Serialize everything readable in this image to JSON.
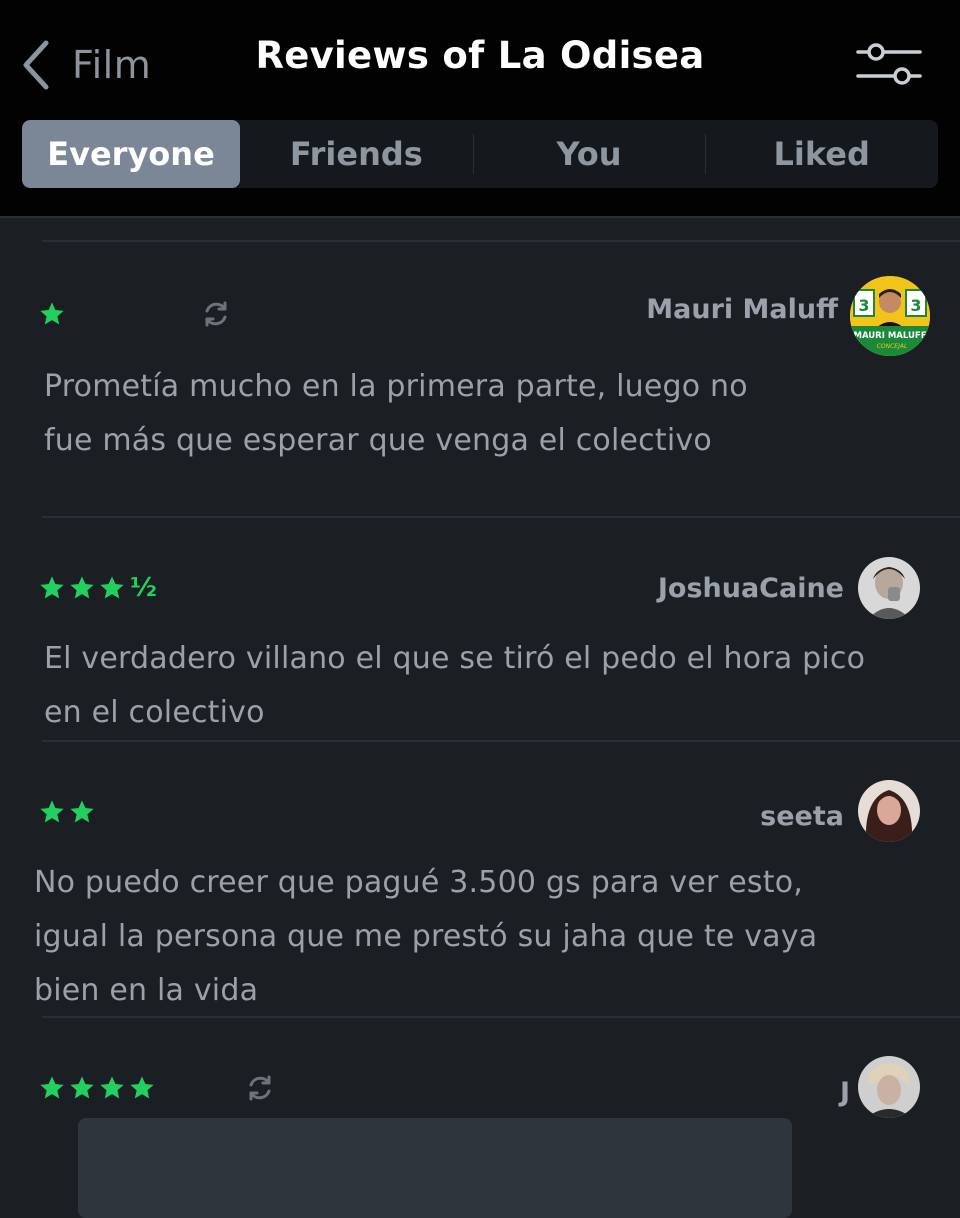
{
  "header": {
    "back_label": "Film",
    "title": "Reviews of La Odisea"
  },
  "tabs": [
    {
      "label": "Everyone",
      "active": true
    },
    {
      "label": "Friends",
      "active": false
    },
    {
      "label": "You",
      "active": false
    },
    {
      "label": "Liked",
      "active": false
    }
  ],
  "reviews": [
    {
      "rating": 1,
      "rewatch": true,
      "username": "Mauri Maluff",
      "avatar_text": "MAURI MALUFF",
      "avatar_sub": "CONCEJAL",
      "avatar_number": "3",
      "text_lines": [
        "Prometía mucho en la primera parte, luego no",
        "fue más que esperar que venga el colectivo"
      ]
    },
    {
      "rating": 3.5,
      "half_symbol": "½",
      "rewatch": false,
      "username": "JoshuaCaine",
      "text_lines": [
        "El verdadero villano el que se tiró el pedo el hora pico",
        "en el colectivo"
      ]
    },
    {
      "rating": 2,
      "rewatch": false,
      "username": "seeta",
      "text_lines": [
        "No puedo creer que pagué 3.500 gs para ver esto,",
        "igual la persona que me prestó su jaha que te vaya",
        "bien en la vida"
      ]
    },
    {
      "rating": 4,
      "rewatch": true,
      "username": "J",
      "text_lines": []
    }
  ],
  "colors": {
    "star": "#21d05e",
    "accent_tab": "#7b8796",
    "background": "#1b1e22"
  },
  "icons": {
    "back": "chevron-left-icon",
    "filter": "sliders-icon",
    "star": "star-icon",
    "rewatch": "rewatch-icon"
  }
}
